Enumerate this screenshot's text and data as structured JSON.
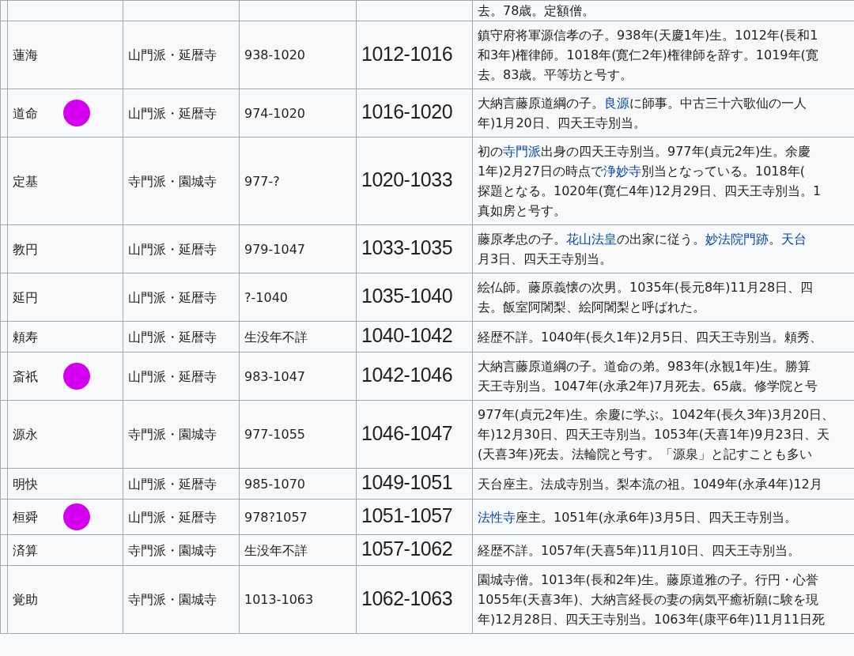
{
  "rows": [
    {
      "name": "",
      "sect": "",
      "lifespan": "",
      "tenure": "",
      "marked": false,
      "description": [
        [
          {
            "text": "去。78歳。定額僧。",
            "link": false
          }
        ]
      ]
    },
    {
      "name": "蓮海",
      "sect": "山門派・延暦寺",
      "lifespan": "938-1020",
      "tenure": "1012-1016",
      "marked": false,
      "description": [
        [
          {
            "text": "鎮守府将軍源信孝の子。938年(天慶1年)生。1012年(長和1",
            "link": false
          }
        ],
        [
          {
            "text": "和3年)権律師。1018年(寛仁2年)権律師を辞す。1019年(寛",
            "link": false
          }
        ],
        [
          {
            "text": "去。83歳。平等坊と号す。",
            "link": false
          }
        ]
      ]
    },
    {
      "name": "道命",
      "sect": "山門派・延暦寺",
      "lifespan": "974-1020",
      "tenure": "1016-1020",
      "marked": true,
      "description": [
        [
          {
            "text": "大納言藤原道綱の子。",
            "link": false
          },
          {
            "text": "良源",
            "link": true
          },
          {
            "text": "に師事。中古三十六歌仙の一人",
            "link": false
          }
        ],
        [
          {
            "text": "年)1月20日、四天王寺別当。",
            "link": false
          }
        ]
      ]
    },
    {
      "name": "定基",
      "sect": "寺門派・園城寺",
      "lifespan": "977-?",
      "tenure": "1020-1033",
      "marked": false,
      "description": [
        [
          {
            "text": "初の",
            "link": false
          },
          {
            "text": "寺門派",
            "link": true
          },
          {
            "text": "出身の四天王寺別当。977年(貞元2年)生。余慶",
            "link": false
          }
        ],
        [
          {
            "text": "1年)2月27日の時点で",
            "link": false
          },
          {
            "text": "浄妙寺",
            "link": true
          },
          {
            "text": "別当となっている。1018年(",
            "link": false
          }
        ],
        [
          {
            "text": "探題となる。1020年(寛仁4年)12月29日、四天王寺別当。1",
            "link": false
          }
        ],
        [
          {
            "text": "真如房と号す。",
            "link": false
          }
        ]
      ]
    },
    {
      "name": "教円",
      "sect": "山門派・延暦寺",
      "lifespan": "979-1047",
      "tenure": "1033-1035",
      "marked": false,
      "description": [
        [
          {
            "text": "藤原孝忠の子。",
            "link": false
          },
          {
            "text": "花山法皇",
            "link": true
          },
          {
            "text": "の出家に従う。",
            "link": false
          },
          {
            "text": "妙法院門跡",
            "link": true
          },
          {
            "text": "。",
            "link": false
          },
          {
            "text": "天台",
            "link": true
          }
        ],
        [
          {
            "text": "月3日、四天王寺別当。",
            "link": false
          }
        ]
      ]
    },
    {
      "name": "延円",
      "sect": "山門派・延暦寺",
      "lifespan": "?-1040",
      "tenure": "1035-1040",
      "marked": false,
      "description": [
        [
          {
            "text": "絵仏師。藤原義懐の次男。1035年(長元8年)11月28日、四",
            "link": false
          }
        ],
        [
          {
            "text": "去。飯室阿闍梨、絵阿闍梨と呼ばれた。",
            "link": false
          }
        ]
      ]
    },
    {
      "name": "頼寿",
      "sect": "山門派・延暦寺",
      "lifespan": "生没年不詳",
      "tenure": "1040-1042",
      "marked": false,
      "description": [
        [
          {
            "text": "経歴不詳。1040年(長久1年)2月5日、四天王寺別当。頼秀、",
            "link": false
          }
        ]
      ]
    },
    {
      "name": "斎祇",
      "sect": "山門派・延暦寺",
      "lifespan": "983-1047",
      "tenure": "1042-1046",
      "marked": true,
      "description": [
        [
          {
            "text": "大納言藤原道綱の子。道命の弟。983年(永観1年)生。勝算",
            "link": false
          }
        ],
        [
          {
            "text": "天王寺別当。1047年(永承2年)7月死去。65歳。修学院と号",
            "link": false
          }
        ]
      ]
    },
    {
      "name": "源永",
      "sect": "寺門派・園城寺",
      "lifespan": "977-1055",
      "tenure": "1046-1047",
      "marked": false,
      "description": [
        [
          {
            "text": "977年(貞元2年)生。余慶に学ぶ。1042年(長久3年)3月20日、",
            "link": false
          }
        ],
        [
          {
            "text": "年)12月30日、四天王寺別当。1053年(天喜1年)9月23日、天",
            "link": false
          }
        ],
        [
          {
            "text": "(天喜3年)死去。法輪院と号す。「源泉」と記すことも多い",
            "link": false
          }
        ]
      ]
    },
    {
      "name": "明快",
      "sect": "山門派・延暦寺",
      "lifespan": "985-1070",
      "tenure": "1049-1051",
      "marked": false,
      "description": [
        [
          {
            "text": "天台座主。法成寺別当。梨本流の祖。1049年(永承4年)12月",
            "link": false
          }
        ]
      ]
    },
    {
      "name": "桓舜",
      "sect": "山門派・延暦寺",
      "lifespan": "978?1057",
      "tenure": "1051-1057",
      "marked": true,
      "description": [
        [
          {
            "text": "法性寺",
            "link": true
          },
          {
            "text": "座主。1051年(永承6年)3月5日、四天王寺別当。",
            "link": false
          }
        ]
      ]
    },
    {
      "name": "済算",
      "sect": "寺門派・園城寺",
      "lifespan": "生没年不詳",
      "tenure": "1057-1062",
      "marked": false,
      "description": [
        [
          {
            "text": "経歴不詳。1057年(天喜5年)11月10日、四天王寺別当。",
            "link": false
          }
        ]
      ]
    },
    {
      "name": "覚助",
      "sect": "寺門派・園城寺",
      "lifespan": "1013-1063",
      "tenure": "1062-1063",
      "marked": false,
      "description": [
        [
          {
            "text": "園城寺僧。1013年(長和2年)生。藤原道雅の子。行円・心誉",
            "link": false
          }
        ],
        [
          {
            "text": "1055年(天喜3年)、大納言経長の妻の病気平癒祈願に験を現",
            "link": false
          }
        ],
        [
          {
            "text": "年)12月28日、四天王寺別当。1063年(康平6年)11月11日死",
            "link": false
          }
        ]
      ]
    }
  ]
}
